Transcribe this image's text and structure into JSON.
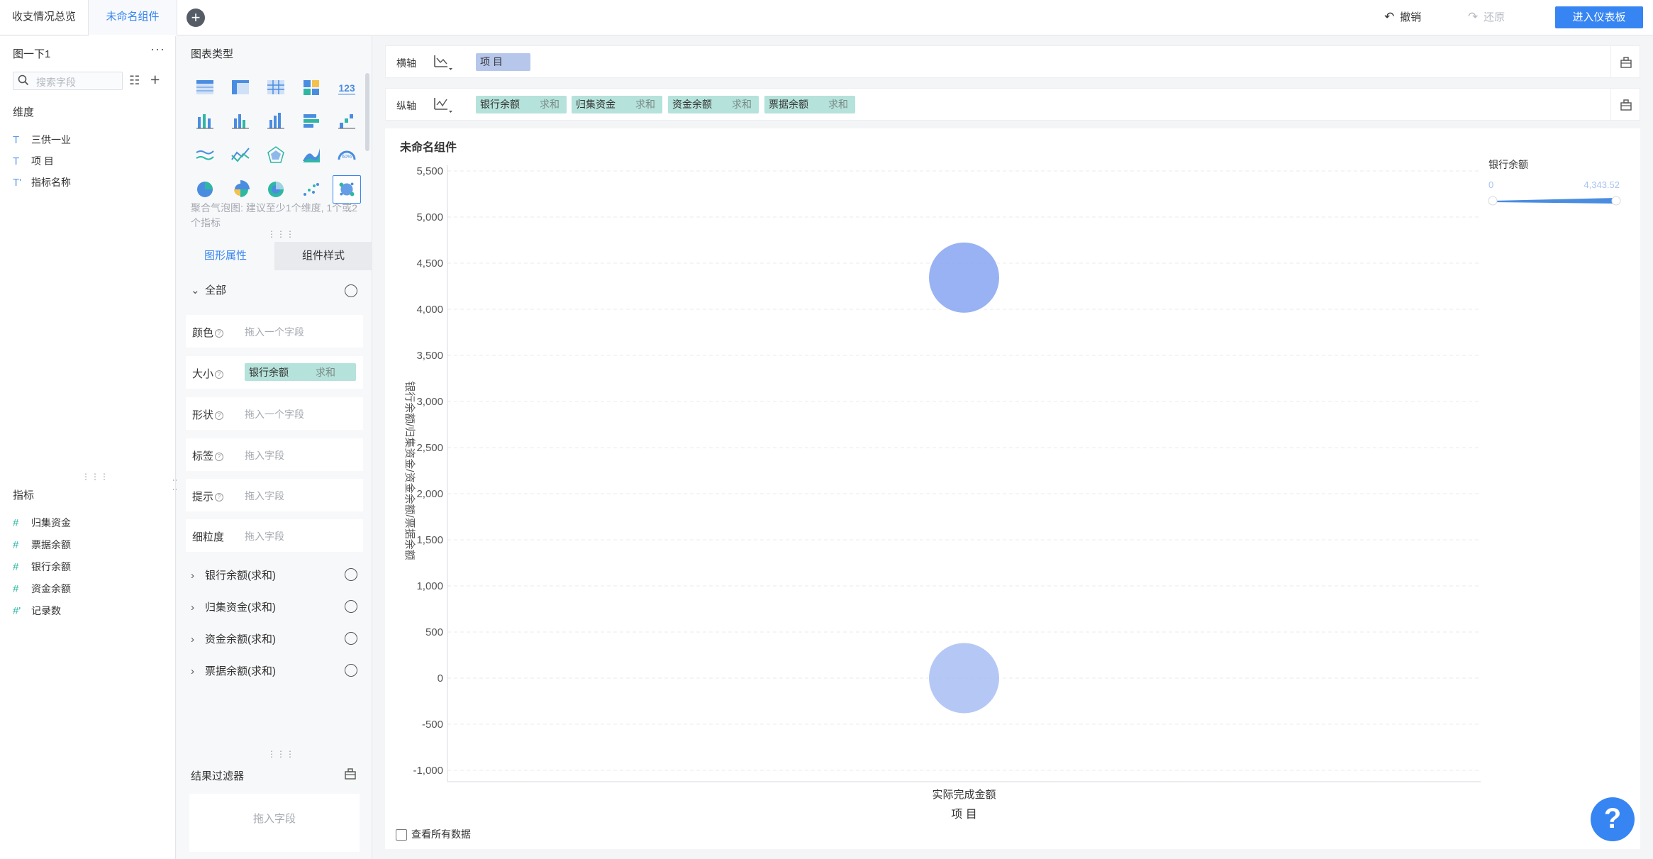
{
  "tabs": [
    {
      "label": "收支情况总览"
    },
    {
      "label": "未命名组件"
    }
  ],
  "toolbar": {
    "undo_label": "撤销",
    "redo_label": "还原",
    "enter_dashboard_label": "进入仪表板"
  },
  "data_panel": {
    "dataset_name": "图一下1",
    "more_label": "···",
    "search_placeholder": "搜索字段",
    "dimension_label": "维度",
    "dimensions": [
      "三供一业",
      "项 目",
      "指标名称"
    ],
    "measure_label": "指标",
    "measures": [
      "归集资金",
      "票据余额",
      "银行余额",
      "资金余额",
      "记录数"
    ]
  },
  "config_panel": {
    "chart_type_label": "图表类型",
    "hint": "聚合气泡图: 建议至少1个维度, 1个或2个指标",
    "subtabs": [
      "图形属性",
      "组件样式"
    ],
    "all_label": "全部",
    "props": [
      {
        "label": "颜色",
        "placeholder": "拖入一个字段"
      },
      {
        "label": "大小",
        "pill_name": "银行余额",
        "pill_suffix": "求和"
      },
      {
        "label": "形状",
        "placeholder": "拖入一个字段"
      },
      {
        "label": "标签",
        "placeholder": "拖入字段"
      },
      {
        "label": "提示",
        "placeholder": "拖入字段"
      },
      {
        "label": "细粒度",
        "placeholder": "拖入字段"
      }
    ],
    "series": [
      "银行余额(求和)",
      "归集资金(求和)",
      "资金余额(求和)",
      "票据余额(求和)"
    ],
    "result_filter_label": "结果过滤器",
    "result_filter_placeholder": "拖入字段"
  },
  "shelves": {
    "x_label": "横轴",
    "x_fields": [
      {
        "name": "项 目"
      }
    ],
    "y_label": "纵轴",
    "y_fields": [
      {
        "name": "银行余额",
        "suffix": "求和"
      },
      {
        "name": "归集资金",
        "suffix": "求和"
      },
      {
        "name": "资金余额",
        "suffix": "求和"
      },
      {
        "name": "票据余额",
        "suffix": "求和"
      }
    ]
  },
  "chart": {
    "title": "未命名组件",
    "view_all_label": "查看所有数据",
    "help_label": "?"
  },
  "chart_data": {
    "type": "scatter",
    "title": "未命名组件",
    "xlabel": "项 目",
    "ylabel": "银行余额/归集资金/资金余额/票据余额",
    "categories": [
      "实际完成金额"
    ],
    "ylim": [
      -1000,
      5500
    ],
    "yticks": [
      -1000,
      -500,
      0,
      500,
      1000,
      1500,
      2000,
      2500,
      3000,
      3500,
      4000,
      4500,
      5000,
      5500
    ],
    "ytick_labels": [
      "-1,000",
      "-500",
      "0",
      "500",
      "1,000",
      "1,500",
      "2,000",
      "2,500",
      "3,000",
      "3,500",
      "4,000",
      "4,500",
      "5,000",
      "5,500"
    ],
    "grid": true,
    "series": [
      {
        "name": "银行余额",
        "values": [
          4343.52
        ]
      },
      {
        "name": "归集资金",
        "values": [
          0
        ]
      },
      {
        "name": "资金余额",
        "values": [
          4343.52
        ]
      },
      {
        "name": "票据余额",
        "values": [
          0
        ]
      }
    ],
    "legend": {
      "title": "银行余额",
      "min_label": "0",
      "max_label": "4,343.52",
      "position": "top-right"
    },
    "colors": {
      "bubble_high": "#7d9ef0",
      "bubble_low": "#a3b9f2",
      "legend_bar": "#4a8de0"
    }
  }
}
